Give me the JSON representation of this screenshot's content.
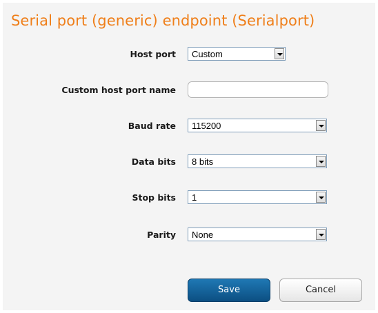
{
  "form": {
    "title": "Serial port (generic) endpoint (Serialport)",
    "fields": {
      "host_port": {
        "label": "Host port",
        "value": "Custom"
      },
      "custom_host_port_name": {
        "label": "Custom host port name",
        "value": ""
      },
      "baud_rate": {
        "label": "Baud rate",
        "value": "115200"
      },
      "data_bits": {
        "label": "Data bits",
        "value": "8 bits"
      },
      "stop_bits": {
        "label": "Stop bits",
        "value": "1"
      },
      "parity": {
        "label": "Parity",
        "value": "None"
      }
    },
    "buttons": {
      "save": "Save",
      "cancel": "Cancel"
    }
  },
  "colors": {
    "title": "#ef7f1a",
    "save_button": "#1568a3",
    "panel_background": "#f4f4f4"
  }
}
